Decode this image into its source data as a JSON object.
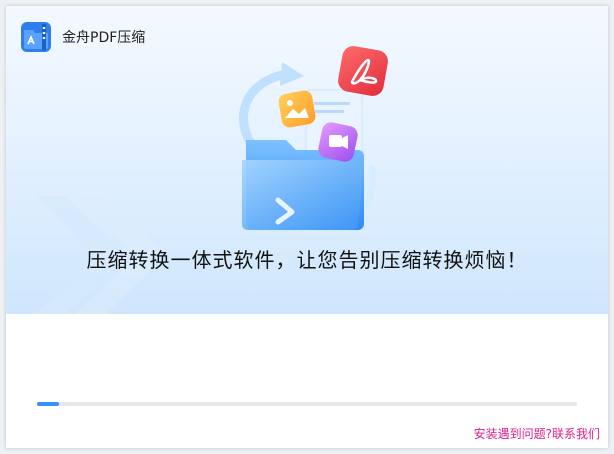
{
  "app": {
    "title": "金舟PDF压缩",
    "logo_icon": "zip-pdf-app-icon"
  },
  "hero": {
    "slogan": "压缩转换一体式软件，让您告别压缩转换烦恼！",
    "illustration_icons": [
      "folder-icon",
      "pdf-icon",
      "image-icon",
      "video-icon",
      "cycle-arrow-icon"
    ]
  },
  "install": {
    "progress": 0.04
  },
  "footer": {
    "help_link": "安装遇到问题?联系我们"
  },
  "colors": {
    "accent": "#3b8ff5",
    "link": "#e0208c",
    "pdf_red": "#f04848"
  }
}
